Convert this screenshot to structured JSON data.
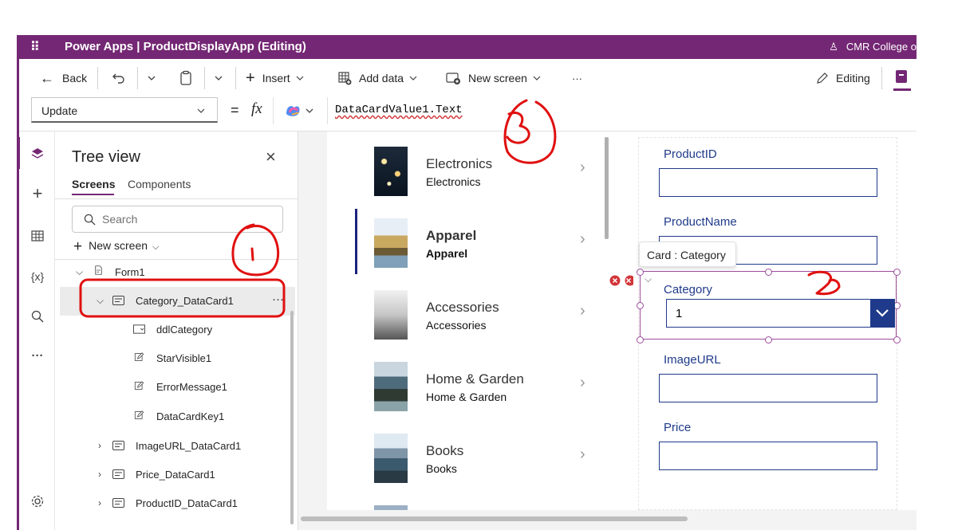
{
  "app": {
    "waffle_icon": "waffle-icon",
    "title": "Power Apps  |  ProductDisplayApp (Editing)",
    "org": "CMR College o"
  },
  "toolbar": {
    "back_label": "Back",
    "insert_label": "Insert",
    "add_data_label": "Add data",
    "new_screen_label": "New screen",
    "more_label": "···",
    "editing_label": "Editing"
  },
  "formula_bar": {
    "property": "Update",
    "equals": "=",
    "fx": "fx",
    "formula": "DataCardValue1.Text"
  },
  "tree": {
    "title": "Tree view",
    "tabs": [
      "Screens",
      "Components"
    ],
    "search_placeholder": "Search",
    "new_screen_label": "New screen",
    "items": [
      {
        "label": "Form1",
        "icon": "form-icon"
      },
      {
        "label": "Category_DataCard1",
        "icon": "card-icon",
        "more": "···"
      },
      {
        "label": "ddlCategory",
        "icon": "dropdown-icon"
      },
      {
        "label": "StarVisible1",
        "icon": "edit-icon"
      },
      {
        "label": "ErrorMessage1",
        "icon": "edit-icon"
      },
      {
        "label": "DataCardKey1",
        "icon": "edit-icon"
      },
      {
        "label": "ImageURL_DataCard1",
        "icon": "card-icon"
      },
      {
        "label": "Price_DataCard1",
        "icon": "card-icon"
      },
      {
        "label": "ProductID_DataCard1",
        "icon": "card-icon"
      }
    ]
  },
  "rail_icons": [
    "layers-icon",
    "plus-icon",
    "table-icon",
    "variables-icon",
    "search-icon",
    "more-icon",
    "settings-icon"
  ],
  "rail_variables_text": "{x}",
  "gallery": [
    {
      "title": "Electronics",
      "subtitle": "Electronics"
    },
    {
      "title": "Apparel",
      "subtitle": "Apparel"
    },
    {
      "title": "Accessories",
      "subtitle": "Accessories"
    },
    {
      "title": "Home & Garden",
      "subtitle": "Home & Garden"
    },
    {
      "title": "Books",
      "subtitle": "Books"
    }
  ],
  "form": {
    "fields": [
      "ProductID",
      "ProductName",
      "Category",
      "ImageURL",
      "Price"
    ],
    "tooltip": "Card : Category",
    "category_value": "1"
  },
  "annotations": {
    "mark_1": "1",
    "mark_2": "2",
    "mark_3": "3"
  },
  "colors": {
    "brand": "#742774",
    "field_border": "#1f3a8a",
    "annotation": "#e01010"
  }
}
